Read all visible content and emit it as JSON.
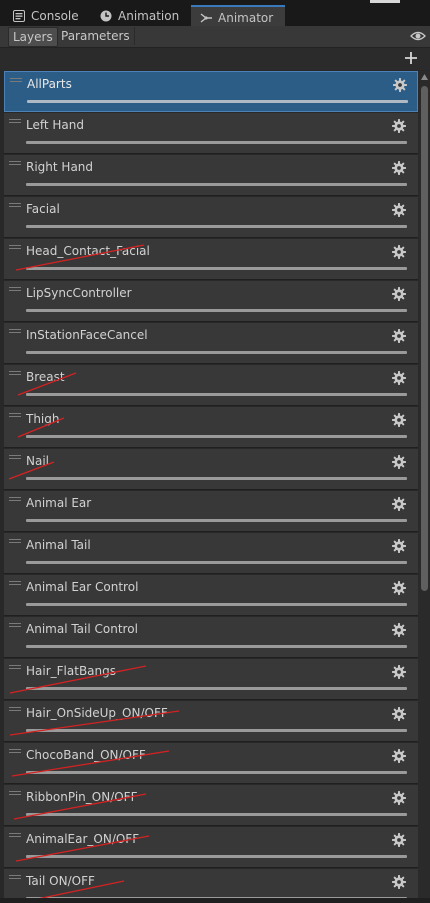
{
  "tabs": [
    {
      "label": "Console",
      "icon": "console-icon",
      "active": false
    },
    {
      "label": "Animation",
      "icon": "animation-clock-icon",
      "active": false
    },
    {
      "label": "Animator",
      "icon": "animator-icon",
      "active": true
    }
  ],
  "toolbar": {
    "layers_label": "Layers",
    "parameters_label": "Parameters",
    "eye_icon": "eye-icon",
    "add_icon": "plus-icon"
  },
  "layers": [
    {
      "name": "AllParts",
      "selected": true,
      "struck": false
    },
    {
      "name": "Left Hand",
      "selected": false,
      "struck": false
    },
    {
      "name": "Right Hand",
      "selected": false,
      "struck": false
    },
    {
      "name": "Facial",
      "selected": false,
      "struck": false
    },
    {
      "name": "Head_Contact_Facial",
      "selected": false,
      "struck": true
    },
    {
      "name": "LipSyncController",
      "selected": false,
      "struck": false
    },
    {
      "name": "InStationFaceCancel",
      "selected": false,
      "struck": false
    },
    {
      "name": "Breast",
      "selected": false,
      "struck": true
    },
    {
      "name": "Thigh",
      "selected": false,
      "struck": true
    },
    {
      "name": "Nail",
      "selected": false,
      "struck": true
    },
    {
      "name": "Animal Ear",
      "selected": false,
      "struck": false
    },
    {
      "name": "Animal Tail",
      "selected": false,
      "struck": false
    },
    {
      "name": "Animal Ear Control",
      "selected": false,
      "struck": false
    },
    {
      "name": "Animal Tail Control",
      "selected": false,
      "struck": false
    },
    {
      "name": "Hair_FlatBangs",
      "selected": false,
      "struck": true
    },
    {
      "name": "Hair_OnSideUp_ON/OFF",
      "selected": false,
      "struck": true
    },
    {
      "name": "ChocoBand_ON/OFF",
      "selected": false,
      "struck": true
    },
    {
      "name": "RibbonPin_ON/OFF",
      "selected": false,
      "struck": true
    },
    {
      "name": "AnimalEar_ON/OFF",
      "selected": false,
      "struck": true
    },
    {
      "name": "Tail ON/OFF",
      "selected": false,
      "struck": true
    }
  ],
  "colors": {
    "selected_row": "#2c5d87",
    "row": "#383838",
    "strike": "#d42222",
    "tab_accent": "#3a79bb"
  }
}
